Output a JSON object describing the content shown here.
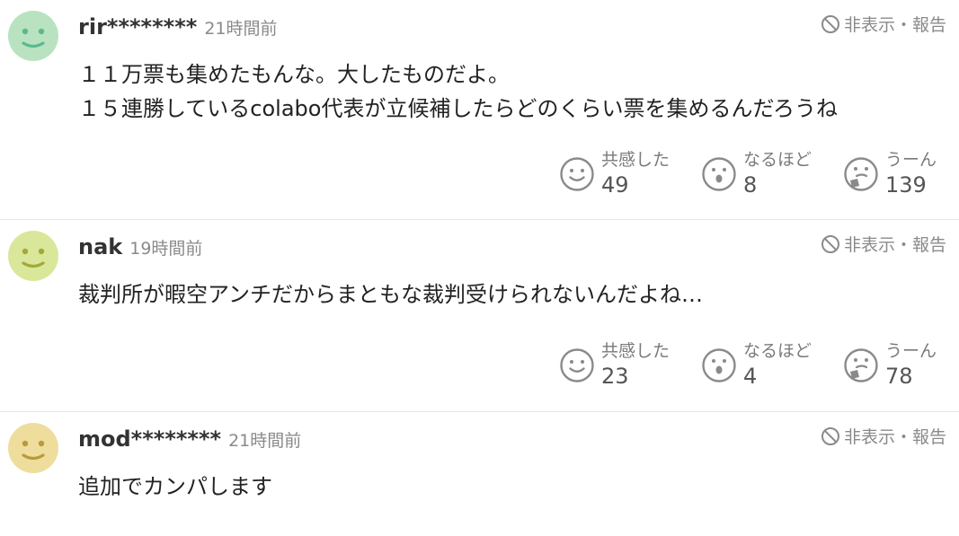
{
  "comments": [
    {
      "username": "rir********",
      "time": "21時間前",
      "hide_report": "非表示・報告",
      "avatar_color": "#b9e3c0",
      "avatar_face_color": "#5cb890",
      "lines": [
        "１１万票も集めたもんな。大したものだよ。",
        "１５連勝しているcolabo代表が立候補したらどのくらい票を集めるんだろうね"
      ],
      "reactions": [
        {
          "label": "共感した",
          "count": "49",
          "icon": "smile-face-icon"
        },
        {
          "label": "なるほど",
          "count": "8",
          "icon": "surprised-face-icon"
        },
        {
          "label": "うーん",
          "count": "139",
          "icon": "thinking-face-icon"
        }
      ]
    },
    {
      "username": "nak",
      "time": "19時間前",
      "hide_report": "非表示・報告",
      "avatar_color": "#d9e79a",
      "avatar_face_color": "#a3a838",
      "lines": [
        "裁判所が暇空アンチだからまともな裁判受けられないんだよね…"
      ],
      "reactions": [
        {
          "label": "共感した",
          "count": "23",
          "icon": "smile-face-icon"
        },
        {
          "label": "なるほど",
          "count": "4",
          "icon": "surprised-face-icon"
        },
        {
          "label": "うーん",
          "count": "78",
          "icon": "thinking-face-icon"
        }
      ]
    },
    {
      "username": "mod********",
      "time": "21時間前",
      "hide_report": "非表示・報告",
      "avatar_color": "#eedd9c",
      "avatar_face_color": "#b89a3c",
      "lines": [
        "追加でカンパします"
      ]
    }
  ]
}
